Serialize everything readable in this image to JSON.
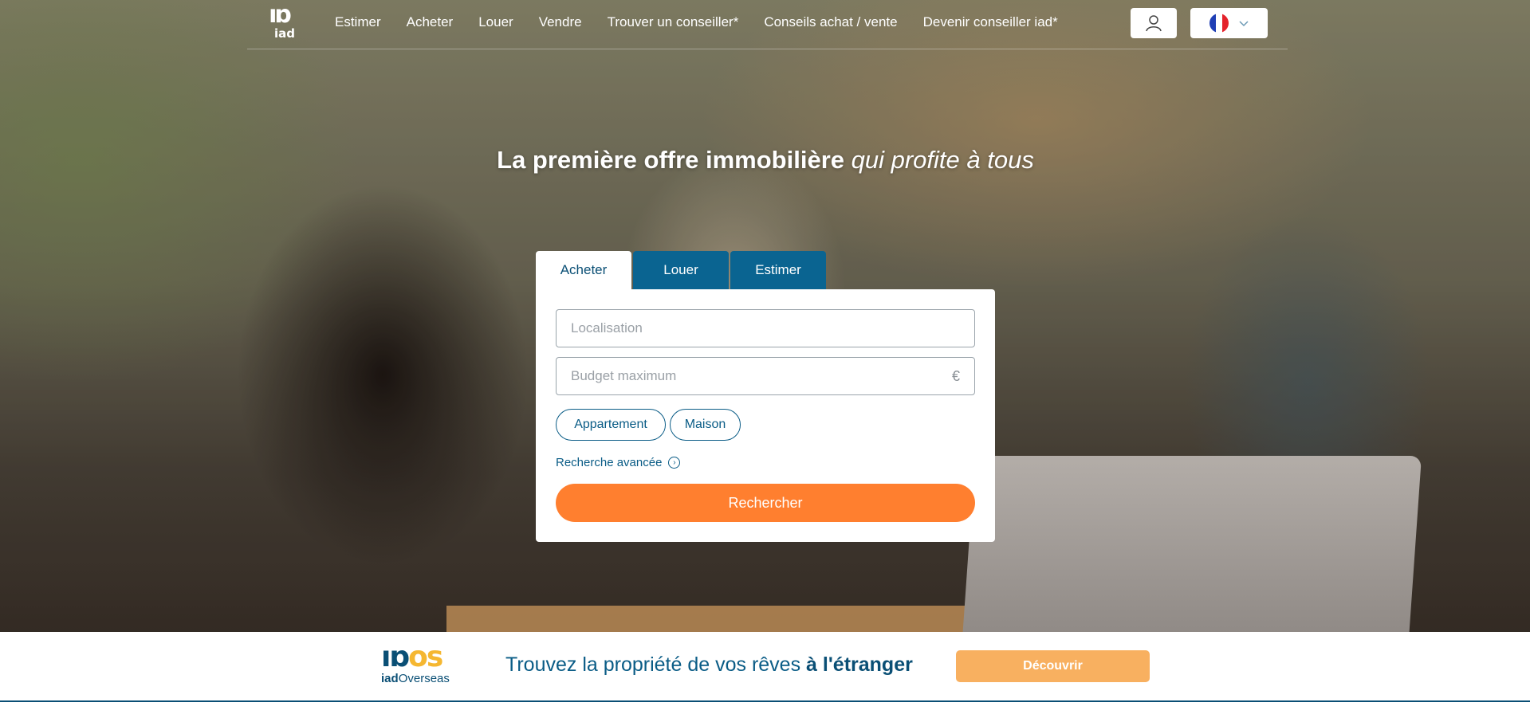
{
  "header": {
    "logo_text": "iad",
    "nav": [
      {
        "label": "Estimer"
      },
      {
        "label": "Acheter"
      },
      {
        "label": "Louer"
      },
      {
        "label": "Vendre"
      },
      {
        "label": "Trouver un conseiller*"
      },
      {
        "label": "Conseils achat / vente"
      },
      {
        "label": "Devenir conseiller iad*"
      }
    ]
  },
  "hero": {
    "headline_bold": "La première offre immobilière",
    "headline_italic": "qui profite à tous"
  },
  "search": {
    "tabs": [
      {
        "label": "Acheter",
        "active": true
      },
      {
        "label": "Louer",
        "active": false
      },
      {
        "label": "Estimer",
        "active": false
      }
    ],
    "location_placeholder": "Localisation",
    "budget_placeholder": "Budget maximum",
    "currency": "€",
    "property_types": [
      "Appartement",
      "Maison"
    ],
    "advanced_label": "Recherche avancée",
    "submit_label": "Rechercher"
  },
  "banner": {
    "logo_word_bold": "iad",
    "logo_word_rest": "Overseas",
    "text_regular": "Trouvez la propriété de vos rêves",
    "text_bold": "à l'étranger",
    "cta_label": "Découvrir"
  },
  "colors": {
    "primary_blue": "#0a6491",
    "accent_orange": "#ff7f2f",
    "banner_button": "#f8b060",
    "overseas_yellow": "#f5b731"
  },
  "icons": [
    "user-icon",
    "france-flag-icon",
    "chevron-down-icon",
    "chevron-right-circle-icon",
    "euro-icon"
  ]
}
